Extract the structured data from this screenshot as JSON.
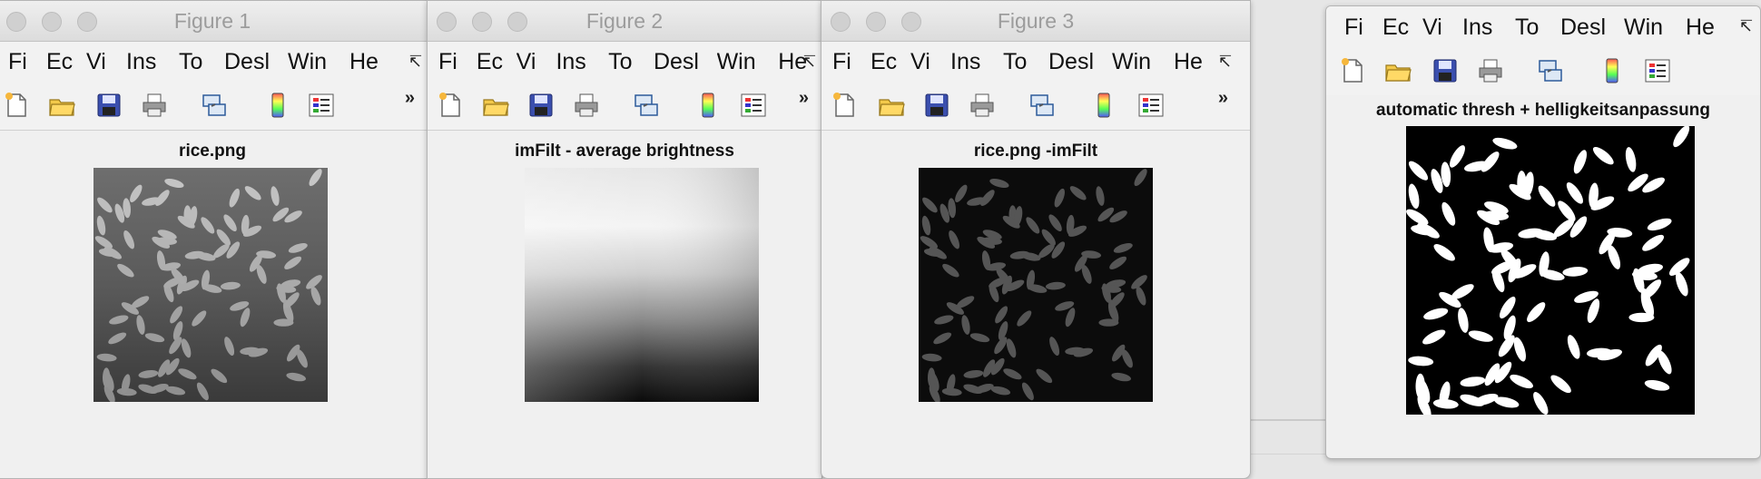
{
  "figures": [
    {
      "window_title": "Figure 1",
      "axes_title": "rice.png"
    },
    {
      "window_title": "Figure 2",
      "axes_title": "imFilt - average brightness"
    },
    {
      "window_title": "Figure 3",
      "axes_title": "rice.png -imFilt"
    },
    {
      "window_title": "",
      "axes_title": "automatic thresh + helligkeitsanpassung"
    }
  ],
  "menu": [
    "Fi",
    "Ec",
    "Vi",
    "Ins",
    "To",
    "Desl",
    "Win",
    "He"
  ],
  "menu_overflow_icon": "menu-overflow-icon",
  "toolbar_overflow_label": "»",
  "toolbar_icons": [
    "new-file-icon",
    "open-folder-icon",
    "save-icon",
    "print-icon",
    "link-plot-icon",
    "colorbar-icon",
    "legend-icon"
  ],
  "colors": {
    "window_bg": "#f0f0f0",
    "titlebar_text": "#9c9c9c",
    "rice_bg": "#555555",
    "rice_grain": "#b8b8b8"
  }
}
